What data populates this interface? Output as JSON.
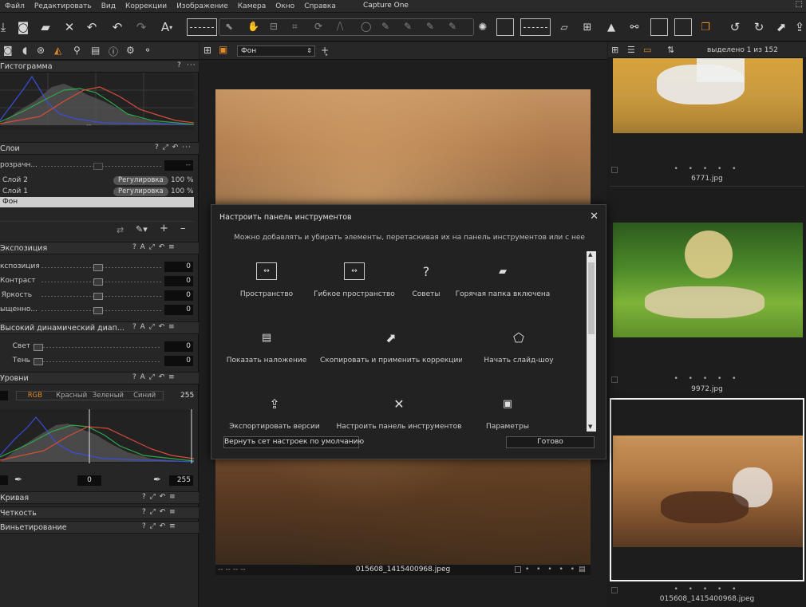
{
  "menu": {
    "items": [
      "Файл",
      "Редактировать",
      "Вид",
      "Коррекции",
      "Изображение",
      "Камера",
      "Окно",
      "Справка"
    ],
    "title": "Capture One",
    "max_icon": "maximize-icon"
  },
  "left": {
    "histogram": {
      "title": "Гистограмма",
      "q": "?",
      "more": "···",
      "mark": "--"
    },
    "layers": {
      "title": "Слои",
      "opacity_label": "розрачн...",
      "opacity_value": "--",
      "items": [
        {
          "name": "Слой 2",
          "type": "Регулировка",
          "percent": "100 %"
        },
        {
          "name": "Слой 1",
          "type": "Регулировка",
          "percent": "100 %"
        },
        {
          "name": "Фон"
        }
      ],
      "add": "+",
      "remove": "–"
    },
    "exposure": {
      "title": "Экспозиция",
      "rows": [
        {
          "label": "кспозиция",
          "value": "0"
        },
        {
          "label": "Контраст",
          "value": "0"
        },
        {
          "label": "Яркость",
          "value": "0"
        },
        {
          "label": "ыщенно...",
          "value": "0"
        }
      ]
    },
    "hdr": {
      "title": "Высокий динамический диап...",
      "rows": [
        {
          "label": "Свет",
          "value": "0"
        },
        {
          "label": "Тень",
          "value": "0"
        }
      ]
    },
    "levels": {
      "title": "Уровни",
      "channels": [
        "RGB",
        "Красный",
        "Зеленый",
        "Синий"
      ],
      "top_value": "255",
      "low_value": "0",
      "high_value": "255"
    },
    "curve": {
      "title": "Кривая"
    },
    "clarity": {
      "title": "Четкость"
    },
    "vignette": {
      "title": "Виньетирование"
    },
    "header_icons": "? A ⤢ ↶ ≡"
  },
  "center": {
    "view_select": "Фон",
    "caption": "015608_1415400968.jpeg",
    "caption_left": "-- -- -- --",
    "caption_dots": "• • • • •"
  },
  "browser": {
    "selected": "выделено 1 из 152",
    "thumbs": [
      {
        "name": "6771.jpg"
      },
      {
        "name": "9972.jpg"
      },
      {
        "name": "015608_1415400968.jpeg"
      }
    ],
    "dots": "• • • • •"
  },
  "dialog": {
    "title": "Настроить панель инструментов",
    "hint": "Можно добавлять и убирать элементы, перетаскивая их на панель инструментов или с нее",
    "items": [
      {
        "label": "Пространство",
        "icon": "space-icon"
      },
      {
        "label": "Гибкое пространство",
        "icon": "flexible-space-icon"
      },
      {
        "label": "Советы",
        "icon": "tips-icon"
      },
      {
        "label": "Горячая папка включена",
        "icon": "hot-folder-icon"
      },
      {
        "label": "Показать наложение",
        "icon": "overlay-icon"
      },
      {
        "label": "Скопировать и применить коррекции",
        "icon": "copy-apply-icon"
      },
      {
        "label": "Начать слайд-шоу",
        "icon": "slideshow-icon"
      },
      {
        "label": "Экспортировать версии",
        "icon": "export-icon"
      },
      {
        "label": "Настроить панель инструментов",
        "icon": "customize-toolbar-icon"
      },
      {
        "label": "Параметры",
        "icon": "preferences-icon"
      }
    ],
    "reset_label": "Вернуть сет настроек по умолчанию",
    "done_label": "Готово",
    "close": "✕"
  }
}
